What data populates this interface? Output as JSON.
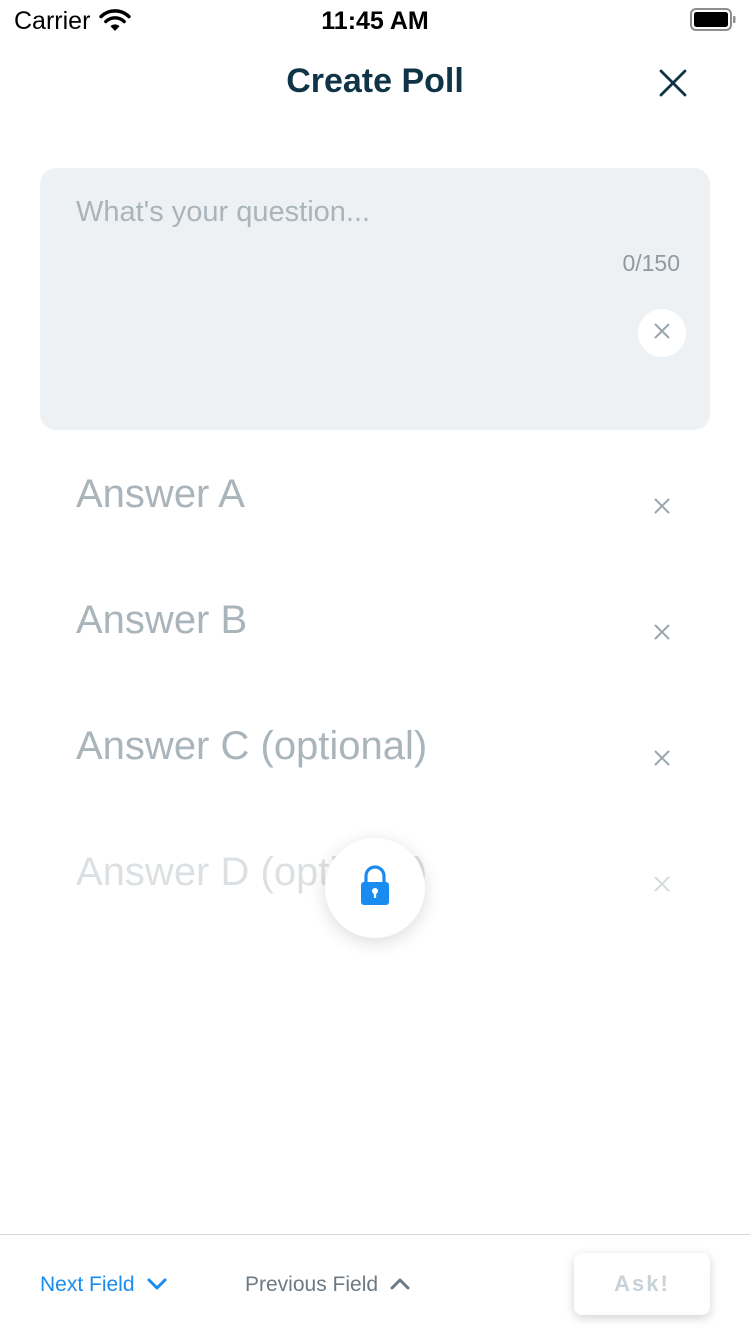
{
  "status_bar": {
    "carrier": "Carrier",
    "time": "11:45 AM",
    "wifi_icon": "wifi-icon",
    "battery_icon": "battery-icon"
  },
  "header": {
    "title": "Create Poll",
    "close_icon": "close-icon"
  },
  "question": {
    "value": "",
    "placeholder": "What's your question...",
    "char_count": "0/150",
    "clear_icon": "close-icon"
  },
  "answers": [
    {
      "value": "",
      "placeholder": "Answer A"
    },
    {
      "value": "",
      "placeholder": "Answer B"
    },
    {
      "value": "",
      "placeholder": "Answer C (optional)"
    },
    {
      "value": "",
      "placeholder": "Answer D (optional)"
    }
  ],
  "lock_button": {
    "icon": "lock-icon"
  },
  "toolbar": {
    "next_field_label": "Next Field",
    "previous_field_label": "Previous Field",
    "ask_label": "Ask!"
  },
  "colors": {
    "title": "#0f3347",
    "accent": "#1a8cf0",
    "card_bg": "#edf1f4",
    "placeholder": "#aab4bb",
    "disabled": "#c8d2d8"
  }
}
